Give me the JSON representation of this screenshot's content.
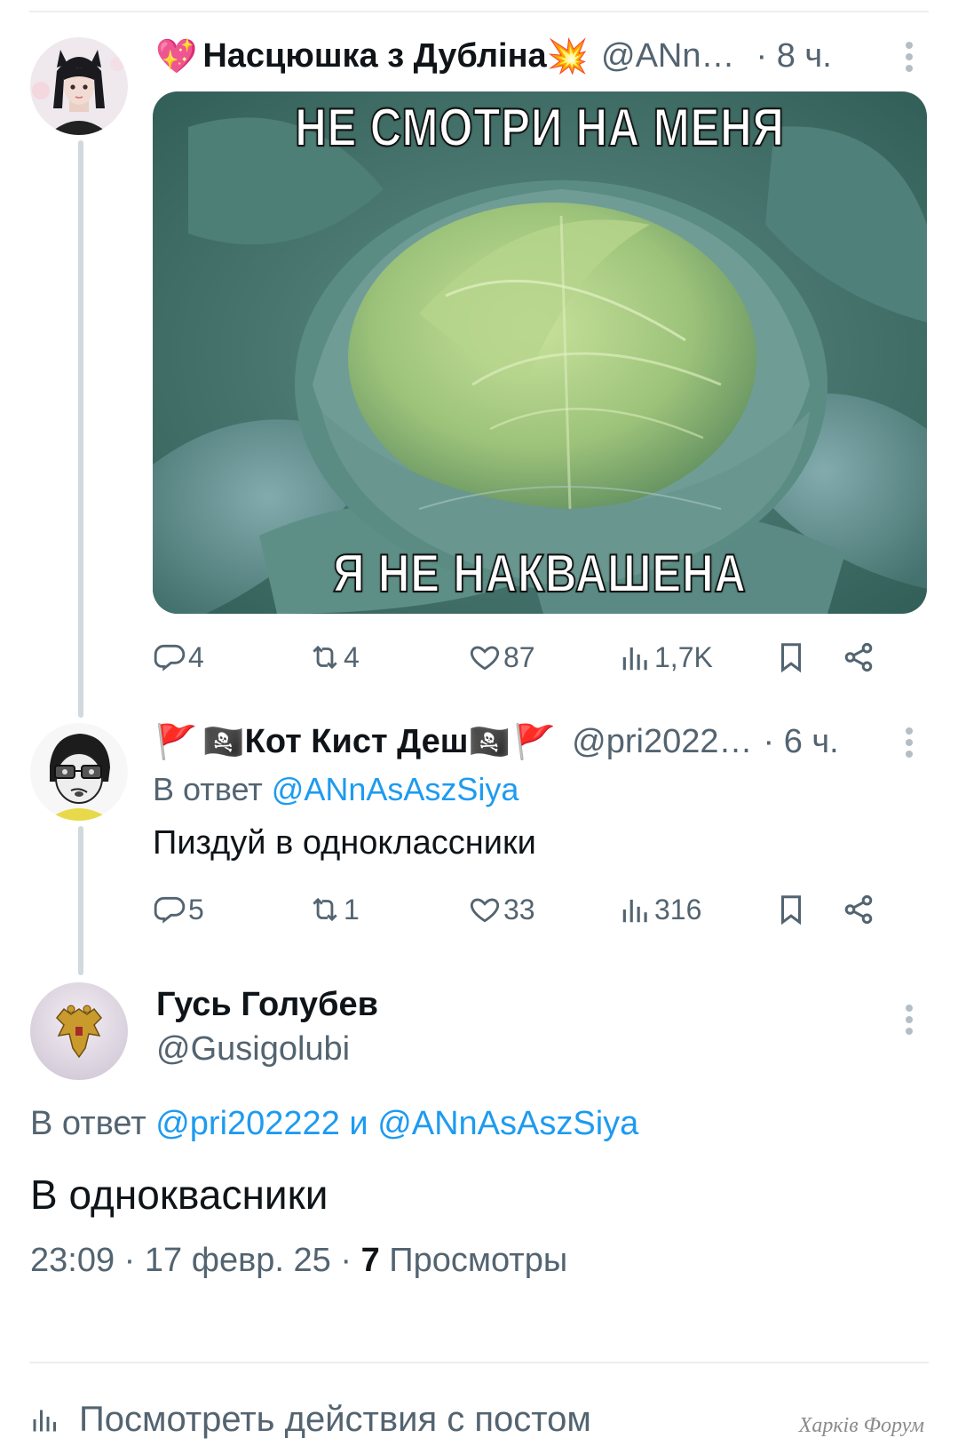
{
  "tweet1": {
    "name_prefix_emoji": "💖",
    "name": "Насцюшка з Дубліна",
    "name_suffix_emoji": "💥",
    "handle": "@ANn…",
    "time": "· 8 ч.",
    "image": {
      "top_caption": "НЕ СМОТРИ НА МЕНЯ",
      "bottom_caption": "Я НЕ НАКВАШЕНА"
    },
    "actions": {
      "replies": "4",
      "retweets": "4",
      "likes": "87",
      "views": "1,7K"
    }
  },
  "tweet2": {
    "name_flag": "🚩",
    "name_pirate": "🏴‍☠️",
    "name": "Кот Кист Деш",
    "handle": "@pri2022…",
    "time": "· 6 ч.",
    "reply_prefix": "В ответ",
    "reply_to": "@ANnAsAszSiya",
    "text": "Пиздуй в одноклассники",
    "actions": {
      "replies": "5",
      "retweets": "1",
      "likes": "33",
      "views": "316"
    }
  },
  "tweet3": {
    "name": "Гусь Голубев",
    "handle": "@Gusigolubi",
    "reply_prefix": "В ответ",
    "reply_to_1": "@pri202222",
    "reply_conj": "и",
    "reply_to_2": "@ANnAsAszSiya",
    "text": "В одноквасники",
    "meta_time": "23:09 · 17 февр. 25 ·",
    "views_count": "7",
    "views_label": "Просмотры"
  },
  "footer": {
    "view_activity": "Посмотреть действия с постом"
  },
  "watermark": "Харків Форум",
  "colors": {
    "text": "#0f1419",
    "secondary": "#536471",
    "link": "#1d9bf0",
    "thread_line": "#cfd9de"
  }
}
